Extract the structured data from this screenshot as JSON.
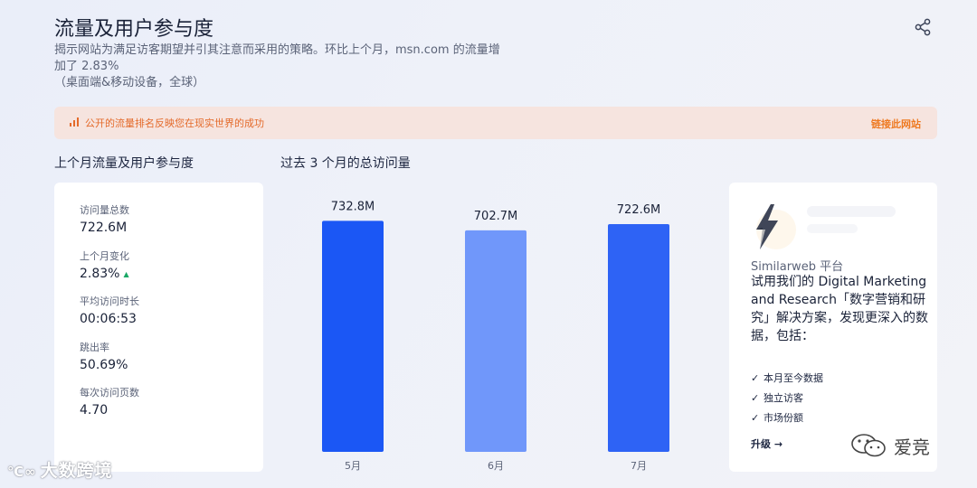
{
  "header": {
    "title": "流量及用户参与度",
    "desc_line1": "揭示网站为满足访客期望并引其注意而采用的策略。环比上个月，msn.com 的流量增",
    "desc_line2": "加了 2.83%",
    "desc_line3": "（桌面端&移动设备，全球）"
  },
  "banner": {
    "text": "公开的流量排名反映您在现实世界的成功",
    "link": "链接此网站"
  },
  "left_section_title": "上个月流量及用户参与度",
  "chart_section_title": "过去 3 个月的总访问量",
  "metrics": [
    {
      "label": "访问量总数",
      "value": "722.6M"
    },
    {
      "label": "上个月变化",
      "value": "2.83%"
    },
    {
      "label": "平均访问时长",
      "value": "00:06:53"
    },
    {
      "label": "跳出率",
      "value": "50.69%"
    },
    {
      "label": "每次访问页数",
      "value": "4.70"
    }
  ],
  "chart_data": {
    "type": "bar",
    "categories": [
      "5月",
      "6月",
      "7月"
    ],
    "values": [
      732.8,
      702.7,
      722.6
    ],
    "value_labels": [
      "732.8M",
      "702.7M",
      "722.6M"
    ],
    "colors": [
      "#1b57f5",
      "#7097fa",
      "#2e63f5"
    ],
    "ylim": [
      0,
      800
    ],
    "title": "过去 3 个月的总访问量"
  },
  "promo": {
    "platform": "Similarweb 平台",
    "pitch": "试用我们的 Digital Marketing and Research「数字营销和研究」解决方案，发现更深入的数据，包括：",
    "features": [
      "本月至今数据",
      "独立访客",
      "市场份额"
    ],
    "upgrade": "升级 →"
  },
  "watermarks": {
    "left": "大数跨境",
    "right": "爱竞"
  },
  "icons": {
    "share": "share-icon",
    "banner": "bar-chart-icon",
    "bolt": "lightning-bolt-icon",
    "check": "check-icon",
    "trend": "trend-up-icon"
  }
}
